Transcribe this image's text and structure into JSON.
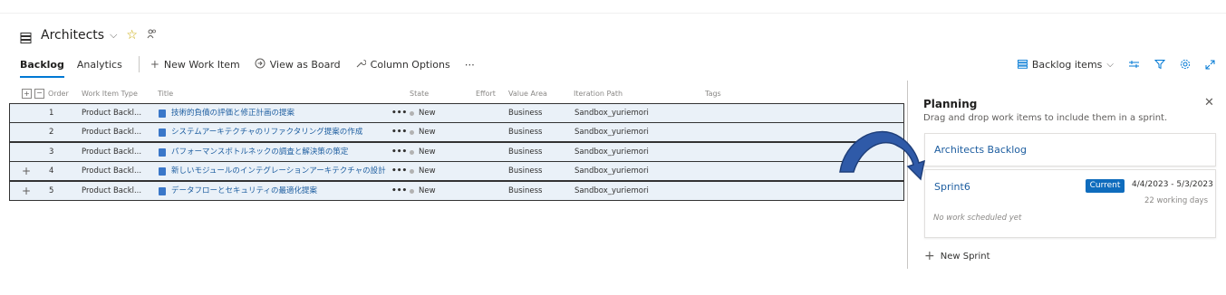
{
  "header": {
    "title": "Architects",
    "chevron": "⌵",
    "star": "☆",
    "people": "ᴿ"
  },
  "toolbar": {
    "tabs": [
      {
        "label": "Backlog"
      },
      {
        "label": "Analytics"
      }
    ],
    "new_work_item": "New Work Item",
    "view_as_board": "View as Board",
    "column_options": "Column Options",
    "more": "⋯",
    "backlog_items": "Backlog items"
  },
  "table": {
    "headers": {
      "order": "Order",
      "type": "Work Item Type",
      "title": "Title",
      "state": "State",
      "effort": "Effort",
      "value_area": "Value Area",
      "iteration": "Iteration Path",
      "tags": "Tags"
    },
    "rows": [
      {
        "plus": "",
        "order": "1",
        "type": "Product Backl...",
        "title": "技術的負債の評価と修正計画の提案",
        "dots": "•••",
        "state": "New",
        "area": "Business",
        "iteration": "Sandbox_yuriemori"
      },
      {
        "plus": "",
        "order": "2",
        "type": "Product Backl...",
        "title": "システムアーキテクチャのリファクタリング提案の作成",
        "dots": "•••",
        "state": "New",
        "area": "Business",
        "iteration": "Sandbox_yuriemori"
      },
      {
        "plus": "",
        "order": "3",
        "type": "Product Backl...",
        "title": "パフォーマンスボトルネックの調査と解決策の策定",
        "dots": "•••",
        "state": "New",
        "area": "Business",
        "iteration": "Sandbox_yuriemori"
      },
      {
        "plus": "+",
        "order": "4",
        "type": "Product Backl...",
        "title": "新しいモジュールのインテグレーションアーキテクチャの設計",
        "dots": "•••",
        "state": "New",
        "area": "Business",
        "iteration": "Sandbox_yuriemori"
      },
      {
        "plus": "+",
        "order": "5",
        "type": "Product Backl...",
        "title": "データフローとセキュリティの最適化提案",
        "dots": "•••",
        "state": "New",
        "area": "Business",
        "iteration": "Sandbox_yuriemori"
      }
    ]
  },
  "planning": {
    "title": "Planning",
    "subtitle": "Drag and drop work items to include them in a sprint.",
    "close": "✕",
    "backlog_card": "Architects Backlog",
    "sprint": {
      "name": "Sprint6",
      "badge": "Current",
      "dates": "4/4/2023 - 5/3/2023",
      "days": "22 working days",
      "empty": "No work scheduled yet"
    },
    "new_sprint": "New Sprint"
  },
  "colors": {
    "accent": "#0078d4",
    "badge": "#0f6cbd",
    "row_bg": "#eaf1f8",
    "link": "#1e5ea0",
    "arrow": "#2f5aa8"
  }
}
